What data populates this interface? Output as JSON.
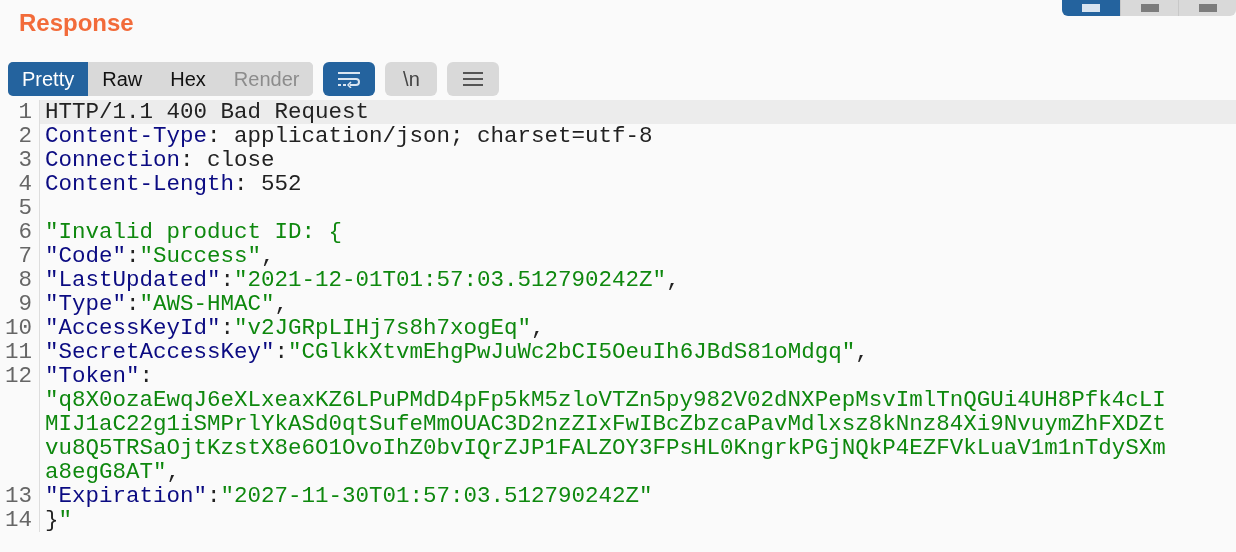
{
  "title": "Response",
  "view_toggle": [
    {
      "selected": true
    },
    {
      "selected": false
    },
    {
      "selected": false
    }
  ],
  "tabs": [
    {
      "label": "Pretty",
      "selected": true,
      "disabled": false
    },
    {
      "label": "Raw",
      "selected": false,
      "disabled": false
    },
    {
      "label": "Hex",
      "selected": false,
      "disabled": false
    },
    {
      "label": "Render",
      "selected": false,
      "disabled": true
    }
  ],
  "tool_buttons": [
    {
      "kind": "wrap",
      "selected": true
    },
    {
      "kind": "text",
      "label": "\\n",
      "selected": false
    },
    {
      "kind": "menu",
      "selected": false
    }
  ],
  "rows": [
    {
      "number": "1",
      "highlighted": true,
      "segments": [
        {
          "kind": "plain",
          "text": "HTTP/1.1 400 Bad Request"
        }
      ]
    },
    {
      "number": "2",
      "highlighted": false,
      "segments": [
        {
          "kind": "key",
          "text": "Content-Type"
        },
        {
          "kind": "plain",
          "text": ": application/json; charset=utf-8"
        }
      ]
    },
    {
      "number": "3",
      "highlighted": false,
      "segments": [
        {
          "kind": "key",
          "text": "Connection"
        },
        {
          "kind": "plain",
          "text": ": close"
        }
      ]
    },
    {
      "number": "4",
      "highlighted": false,
      "segments": [
        {
          "kind": "key",
          "text": "Content-Length"
        },
        {
          "kind": "plain",
          "text": ": 552"
        }
      ]
    },
    {
      "number": "5",
      "highlighted": false,
      "segments": []
    },
    {
      "number": "6",
      "highlighted": false,
      "segments": [
        {
          "kind": "value",
          "text": "\"Invalid product ID: {"
        }
      ]
    },
    {
      "number": "7",
      "highlighted": false,
      "segments": [
        {
          "kind": "key",
          "text": "\"Code\""
        },
        {
          "kind": "plain",
          "text": ":"
        },
        {
          "kind": "value",
          "text": "\"Success\""
        },
        {
          "kind": "plain",
          "text": ","
        }
      ]
    },
    {
      "number": "8",
      "highlighted": false,
      "segments": [
        {
          "kind": "key",
          "text": "\"LastUpdated\""
        },
        {
          "kind": "plain",
          "text": ":"
        },
        {
          "kind": "value",
          "text": "\"2021-12-01T01:57:03.512790242Z\""
        },
        {
          "kind": "plain",
          "text": ","
        }
      ]
    },
    {
      "number": "9",
      "highlighted": false,
      "segments": [
        {
          "kind": "key",
          "text": "\"Type\""
        },
        {
          "kind": "plain",
          "text": ":"
        },
        {
          "kind": "value",
          "text": "\"AWS-HMAC\""
        },
        {
          "kind": "plain",
          "text": ","
        }
      ]
    },
    {
      "number": "10",
      "highlighted": false,
      "segments": [
        {
          "kind": "key",
          "text": "\"AccessKeyId\""
        },
        {
          "kind": "plain",
          "text": ":"
        },
        {
          "kind": "value",
          "text": "\"v2JGRpLIHj7s8h7xogEq\""
        },
        {
          "kind": "plain",
          "text": ","
        }
      ]
    },
    {
      "number": "11",
      "highlighted": false,
      "segments": [
        {
          "kind": "key",
          "text": "\"SecretAccessKey\""
        },
        {
          "kind": "plain",
          "text": ":"
        },
        {
          "kind": "value",
          "text": "\"CGlkkXtvmEhgPwJuWc2bCI5OeuIh6JBdS81oMdgq\""
        },
        {
          "kind": "plain",
          "text": ","
        }
      ]
    },
    {
      "number": "12",
      "highlighted": false,
      "segments": [
        {
          "kind": "key",
          "text": "\"Token\""
        },
        {
          "kind": "plain",
          "text": ":"
        }
      ]
    },
    {
      "highlighted": false,
      "segments": [
        {
          "kind": "value",
          "text": "\"q8X0ozaEwqJ6eXLxeaxKZ6LPuPMdD4pFp5kM5zloVTZn5py982V02dNXPepMsvImlTnQGUi4UH8Pfk4cLI"
        }
      ]
    },
    {
      "highlighted": false,
      "segments": [
        {
          "kind": "value",
          "text": "MIJ1aC22g1iSMPrlYkASd0qtSufeMmOUAC3D2nzZIxFwIBcZbzcaPavMdlxsz8kNnz84Xi9NvuymZhFXDZt"
        }
      ]
    },
    {
      "highlighted": false,
      "segments": [
        {
          "kind": "value",
          "text": "vu8Q5TRSaOjtKzstX8e6O1OvoIhZ0bvIQrZJP1FALZOY3FPsHL0KngrkPGjNQkP4EZFVkLuaV1m1nTdySXm"
        }
      ]
    },
    {
      "highlighted": false,
      "segments": [
        {
          "kind": "value",
          "text": "a8egG8AT\""
        },
        {
          "kind": "plain",
          "text": ","
        }
      ]
    },
    {
      "number": "13",
      "highlighted": false,
      "segments": [
        {
          "kind": "key",
          "text": "\"Expiration\""
        },
        {
          "kind": "plain",
          "text": ":"
        },
        {
          "kind": "value",
          "text": "\"2027-11-30T01:57:03.512790242Z\""
        }
      ]
    },
    {
      "number": "14",
      "highlighted": false,
      "segments": [
        {
          "kind": "plain",
          "text": "}"
        },
        {
          "kind": "value",
          "text": "\""
        }
      ]
    }
  ]
}
